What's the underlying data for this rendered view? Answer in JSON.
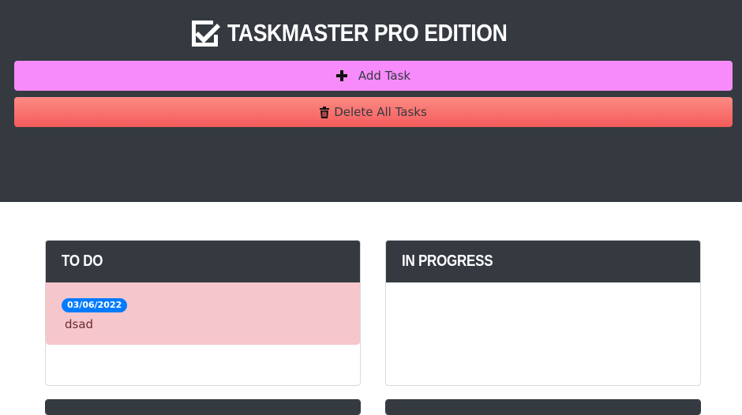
{
  "app": {
    "title": "TASKMASTER PRO EDITION",
    "title_icon": "check-square-icon"
  },
  "toolbar": {
    "add_label": "Add Task",
    "add_icon": "plus-icon",
    "delete_label": "Delete All Tasks",
    "delete_icon": "trash-icon"
  },
  "columns": [
    {
      "title": "TO DO",
      "tasks": [
        {
          "date": "03/06/2022",
          "text": "dsad"
        }
      ]
    },
    {
      "title": "IN PROGRESS",
      "tasks": []
    }
  ],
  "colors": {
    "header_bg": "#343a40",
    "add_button": "#f78bfb",
    "delete_button": "#f55b5b",
    "task_bg": "#f5c6cb",
    "badge_bg": "#007bff"
  }
}
